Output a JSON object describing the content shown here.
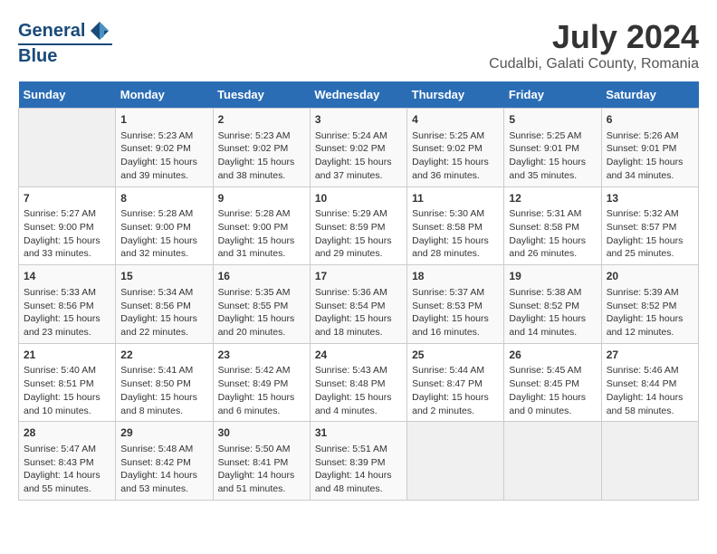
{
  "header": {
    "logo_line1": "General",
    "logo_line2": "Blue",
    "month_year": "July 2024",
    "location": "Cudalbi, Galati County, Romania"
  },
  "days_of_week": [
    "Sunday",
    "Monday",
    "Tuesday",
    "Wednesday",
    "Thursday",
    "Friday",
    "Saturday"
  ],
  "weeks": [
    [
      {
        "num": "",
        "info": ""
      },
      {
        "num": "1",
        "info": "Sunrise: 5:23 AM\nSunset: 9:02 PM\nDaylight: 15 hours\nand 39 minutes."
      },
      {
        "num": "2",
        "info": "Sunrise: 5:23 AM\nSunset: 9:02 PM\nDaylight: 15 hours\nand 38 minutes."
      },
      {
        "num": "3",
        "info": "Sunrise: 5:24 AM\nSunset: 9:02 PM\nDaylight: 15 hours\nand 37 minutes."
      },
      {
        "num": "4",
        "info": "Sunrise: 5:25 AM\nSunset: 9:02 PM\nDaylight: 15 hours\nand 36 minutes."
      },
      {
        "num": "5",
        "info": "Sunrise: 5:25 AM\nSunset: 9:01 PM\nDaylight: 15 hours\nand 35 minutes."
      },
      {
        "num": "6",
        "info": "Sunrise: 5:26 AM\nSunset: 9:01 PM\nDaylight: 15 hours\nand 34 minutes."
      }
    ],
    [
      {
        "num": "7",
        "info": "Sunrise: 5:27 AM\nSunset: 9:00 PM\nDaylight: 15 hours\nand 33 minutes."
      },
      {
        "num": "8",
        "info": "Sunrise: 5:28 AM\nSunset: 9:00 PM\nDaylight: 15 hours\nand 32 minutes."
      },
      {
        "num": "9",
        "info": "Sunrise: 5:28 AM\nSunset: 9:00 PM\nDaylight: 15 hours\nand 31 minutes."
      },
      {
        "num": "10",
        "info": "Sunrise: 5:29 AM\nSunset: 8:59 PM\nDaylight: 15 hours\nand 29 minutes."
      },
      {
        "num": "11",
        "info": "Sunrise: 5:30 AM\nSunset: 8:58 PM\nDaylight: 15 hours\nand 28 minutes."
      },
      {
        "num": "12",
        "info": "Sunrise: 5:31 AM\nSunset: 8:58 PM\nDaylight: 15 hours\nand 26 minutes."
      },
      {
        "num": "13",
        "info": "Sunrise: 5:32 AM\nSunset: 8:57 PM\nDaylight: 15 hours\nand 25 minutes."
      }
    ],
    [
      {
        "num": "14",
        "info": "Sunrise: 5:33 AM\nSunset: 8:56 PM\nDaylight: 15 hours\nand 23 minutes."
      },
      {
        "num": "15",
        "info": "Sunrise: 5:34 AM\nSunset: 8:56 PM\nDaylight: 15 hours\nand 22 minutes."
      },
      {
        "num": "16",
        "info": "Sunrise: 5:35 AM\nSunset: 8:55 PM\nDaylight: 15 hours\nand 20 minutes."
      },
      {
        "num": "17",
        "info": "Sunrise: 5:36 AM\nSunset: 8:54 PM\nDaylight: 15 hours\nand 18 minutes."
      },
      {
        "num": "18",
        "info": "Sunrise: 5:37 AM\nSunset: 8:53 PM\nDaylight: 15 hours\nand 16 minutes."
      },
      {
        "num": "19",
        "info": "Sunrise: 5:38 AM\nSunset: 8:52 PM\nDaylight: 15 hours\nand 14 minutes."
      },
      {
        "num": "20",
        "info": "Sunrise: 5:39 AM\nSunset: 8:52 PM\nDaylight: 15 hours\nand 12 minutes."
      }
    ],
    [
      {
        "num": "21",
        "info": "Sunrise: 5:40 AM\nSunset: 8:51 PM\nDaylight: 15 hours\nand 10 minutes."
      },
      {
        "num": "22",
        "info": "Sunrise: 5:41 AM\nSunset: 8:50 PM\nDaylight: 15 hours\nand 8 minutes."
      },
      {
        "num": "23",
        "info": "Sunrise: 5:42 AM\nSunset: 8:49 PM\nDaylight: 15 hours\nand 6 minutes."
      },
      {
        "num": "24",
        "info": "Sunrise: 5:43 AM\nSunset: 8:48 PM\nDaylight: 15 hours\nand 4 minutes."
      },
      {
        "num": "25",
        "info": "Sunrise: 5:44 AM\nSunset: 8:47 PM\nDaylight: 15 hours\nand 2 minutes."
      },
      {
        "num": "26",
        "info": "Sunrise: 5:45 AM\nSunset: 8:45 PM\nDaylight: 15 hours\nand 0 minutes."
      },
      {
        "num": "27",
        "info": "Sunrise: 5:46 AM\nSunset: 8:44 PM\nDaylight: 14 hours\nand 58 minutes."
      }
    ],
    [
      {
        "num": "28",
        "info": "Sunrise: 5:47 AM\nSunset: 8:43 PM\nDaylight: 14 hours\nand 55 minutes."
      },
      {
        "num": "29",
        "info": "Sunrise: 5:48 AM\nSunset: 8:42 PM\nDaylight: 14 hours\nand 53 minutes."
      },
      {
        "num": "30",
        "info": "Sunrise: 5:50 AM\nSunset: 8:41 PM\nDaylight: 14 hours\nand 51 minutes."
      },
      {
        "num": "31",
        "info": "Sunrise: 5:51 AM\nSunset: 8:39 PM\nDaylight: 14 hours\nand 48 minutes."
      },
      {
        "num": "",
        "info": ""
      },
      {
        "num": "",
        "info": ""
      },
      {
        "num": "",
        "info": ""
      }
    ]
  ]
}
